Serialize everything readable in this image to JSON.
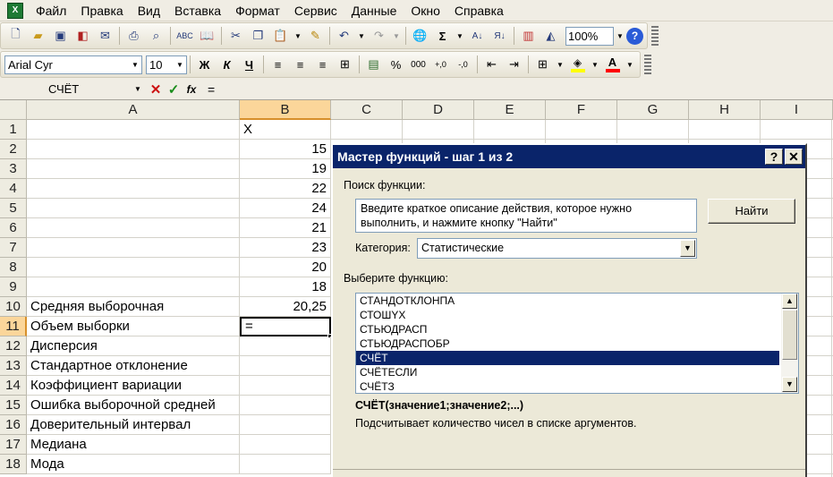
{
  "menu": [
    "Файл",
    "Правка",
    "Вид",
    "Вставка",
    "Формат",
    "Сервис",
    "Данные",
    "Окно",
    "Справка"
  ],
  "app_icon": "excel-icon",
  "toolbar": {
    "zoom": "100%",
    "sum_symbol": "Σ"
  },
  "format_toolbar": {
    "font_name": "Arial Cyr",
    "font_size": "10",
    "bold": "Ж",
    "italic": "К",
    "underline": "Ч",
    "percent": "%",
    "thousands": "000",
    "text_color": "#ff0000",
    "fill_color": "#ffff00"
  },
  "formula_bar": {
    "name_box": "СЧЁТ",
    "formula": "="
  },
  "columns": [
    "A",
    "B",
    "C",
    "D",
    "E",
    "F",
    "G",
    "H",
    "I"
  ],
  "rows": [
    {
      "num": "1",
      "a": "",
      "b": "X"
    },
    {
      "num": "2",
      "a": "",
      "b": "15"
    },
    {
      "num": "3",
      "a": "",
      "b": "19"
    },
    {
      "num": "4",
      "a": "",
      "b": "22"
    },
    {
      "num": "5",
      "a": "",
      "b": "24"
    },
    {
      "num": "6",
      "a": "",
      "b": "21"
    },
    {
      "num": "7",
      "a": "",
      "b": "23"
    },
    {
      "num": "8",
      "a": "",
      "b": "20"
    },
    {
      "num": "9",
      "a": "",
      "b": "18"
    },
    {
      "num": "10",
      "a": "Средняя выборочная",
      "b": "20,25"
    },
    {
      "num": "11",
      "a": "Объем выборки",
      "b": "="
    },
    {
      "num": "12",
      "a": "Дисперсия",
      "b": ""
    },
    {
      "num": "13",
      "a": "Стандартное отклонение",
      "b": ""
    },
    {
      "num": "14",
      "a": "Коэффициент вариации",
      "b": ""
    },
    {
      "num": "15",
      "a": "Ошибка выборочной средней",
      "b": ""
    },
    {
      "num": "16",
      "a": "Доверительный интервал",
      "b": ""
    },
    {
      "num": "17",
      "a": "Медиана",
      "b": ""
    },
    {
      "num": "18",
      "a": "Мода",
      "b": ""
    }
  ],
  "dialog": {
    "title": "Мастер функций - шаг 1 из 2",
    "help_btn": "?",
    "close_btn": "✕",
    "search_label": "Поиск функции:",
    "search_text": "Введите краткое описание действия, которое нужно выполнить, и нажмите кнопку \"Найти\"",
    "find_button": "Найти",
    "category_label": "Категория:",
    "category_value": "Статистические",
    "choose_label": "Выберите функцию:",
    "functions": [
      "СТАНДОТКЛОНПА",
      "СТОШYX",
      "СТЬЮДРАСП",
      "СТЬЮДРАСПОБР",
      "СЧЁТ",
      "СЧЁТЕСЛИ",
      "СЧЁТЗ"
    ],
    "selected_function": "СЧЁТ",
    "syntax": "СЧЁТ(значение1;значение2;...)",
    "description": "Подсчитывает количество чисел в списке аргументов."
  }
}
